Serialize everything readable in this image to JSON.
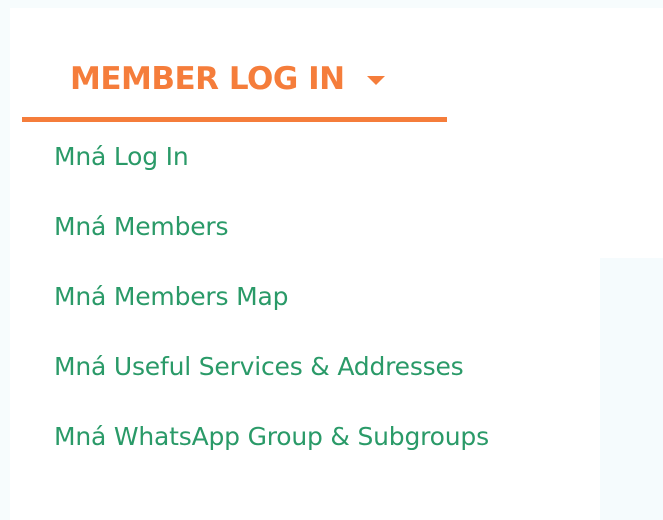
{
  "menu": {
    "label": "MEMBER LOG IN",
    "accent_color": "#f57d3b",
    "link_color": "#2a9a68",
    "caret_icon": "caret-down-icon",
    "items": [
      {
        "label": "Mná Log In"
      },
      {
        "label": "Mná Members"
      },
      {
        "label": "Mná Members Map"
      },
      {
        "label": "Mná Useful Services & Addresses"
      },
      {
        "label": "Mná WhatsApp Group & Subgroups"
      }
    ]
  }
}
